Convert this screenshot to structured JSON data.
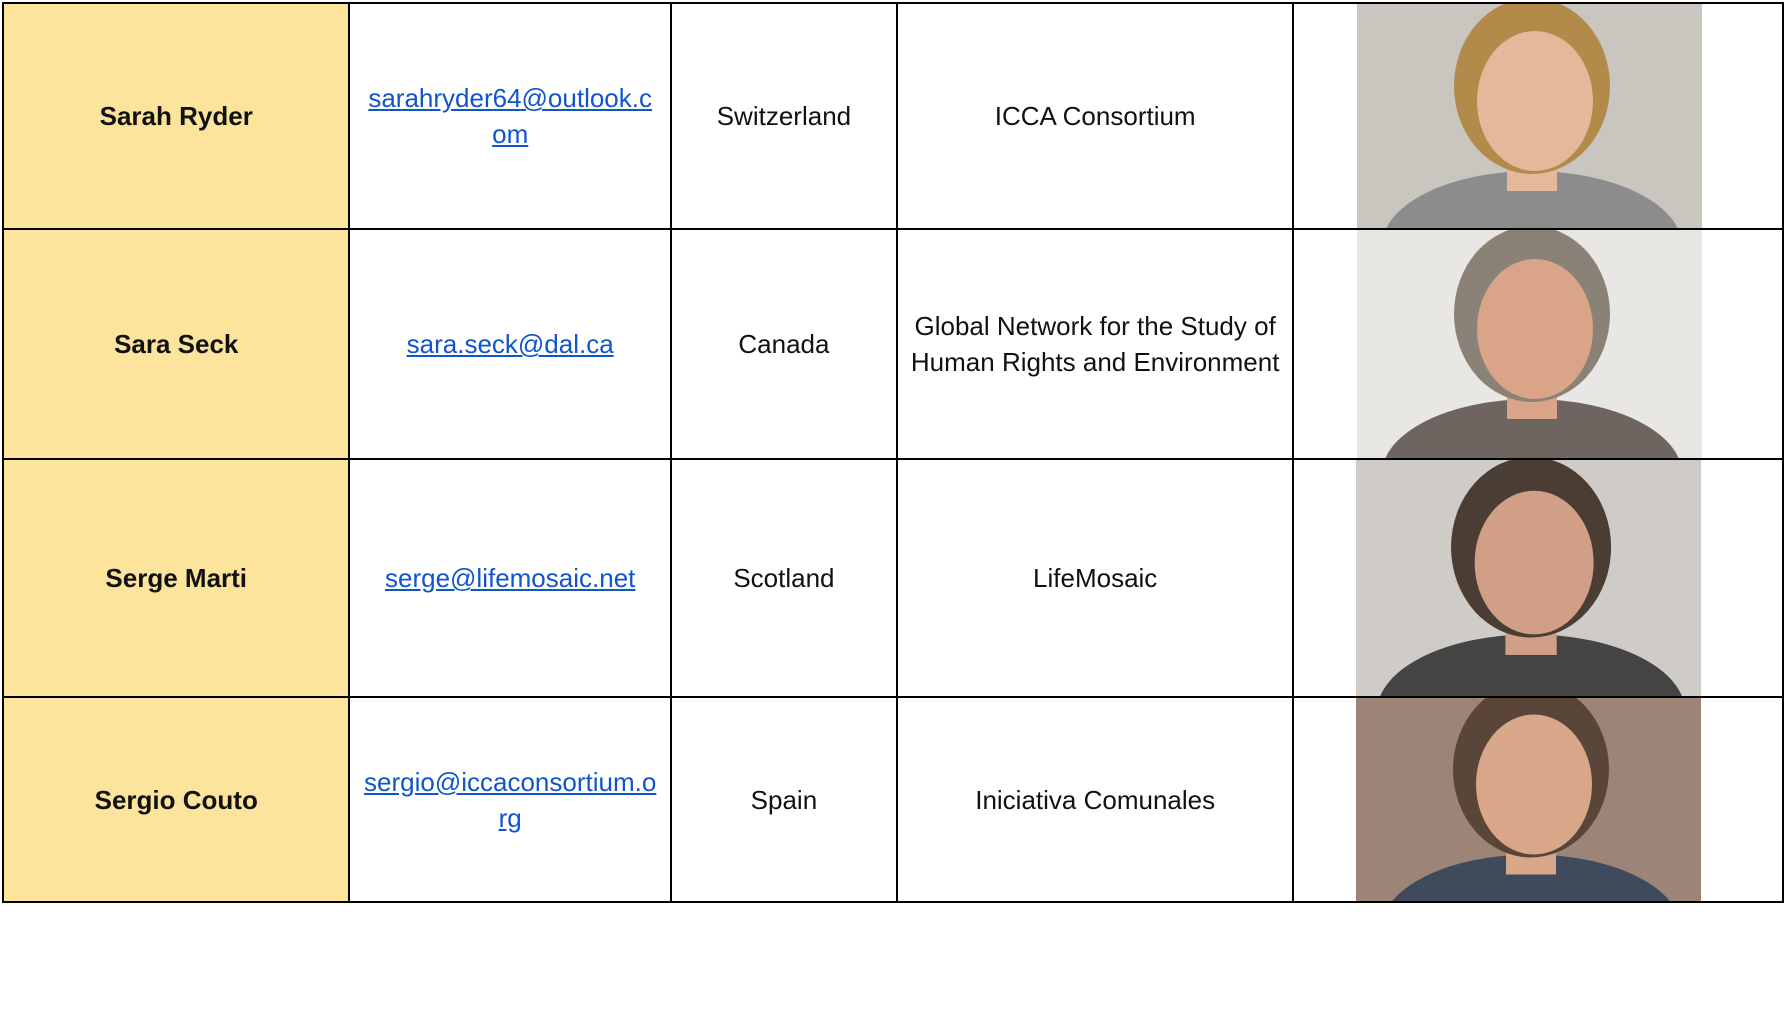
{
  "rows": [
    {
      "name": "Sarah Ryder",
      "email": "sarahryder64@outlook.com",
      "country": "Switzerland",
      "organization": "ICCA Consortium",
      "photo": {
        "icon": "person-photo-woman-blonde",
        "bg": "#c9c6c0",
        "hair": "#b28a4a",
        "skin": "#e4b89a",
        "shirt": "#8c8c8c"
      }
    },
    {
      "name": "Sara Seck",
      "email": "sara.seck@dal.ca ",
      "country": "Canada",
      "organization": "Global Network for the Study of Human Rights and Environment",
      "photo": {
        "icon": "person-photo-woman-glasses",
        "bg": "#e9e7e4",
        "hair": "#8a8276",
        "skin": "#d9a488",
        "shirt": "#6f6560"
      }
    },
    {
      "name": "Serge Marti",
      "email": "serge@lifemosaic.net",
      "country": "Scotland",
      "organization": "LifeMosaic",
      "photo": {
        "icon": "person-photo-man-glasses",
        "bg": "#cfcbc6",
        "hair": "#4a3d34",
        "skin": "#d09f86",
        "shirt": "#444444"
      }
    },
    {
      "name": "Sergio Couto",
      "email": "sergio@iccaconsortium.org",
      "country": "Spain",
      "organization": "Iniciativa Comunales",
      "photo": {
        "icon": "person-photo-man-beard",
        "bg": "#9c8577",
        "hair": "#5a4638",
        "skin": "#d8a789",
        "shirt": "#3f4a5c"
      }
    }
  ]
}
